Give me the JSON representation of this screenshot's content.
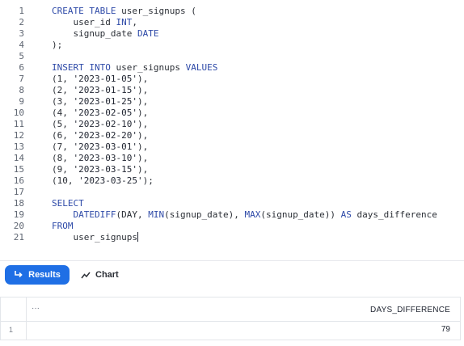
{
  "editor": {
    "lines": [
      {
        "n": "1",
        "parts": [
          {
            "t": "CREATE TABLE",
            "c": "kw"
          },
          {
            "t": " user_signups ("
          }
        ]
      },
      {
        "n": "2",
        "parts": [
          {
            "t": "    user_id "
          },
          {
            "t": "INT",
            "c": "kw"
          },
          {
            "t": ","
          }
        ]
      },
      {
        "n": "3",
        "parts": [
          {
            "t": "    signup_date "
          },
          {
            "t": "DATE",
            "c": "kw"
          }
        ]
      },
      {
        "n": "4",
        "parts": [
          {
            "t": ");"
          }
        ]
      },
      {
        "n": "5",
        "parts": []
      },
      {
        "n": "6",
        "parts": [
          {
            "t": "INSERT INTO",
            "c": "kw"
          },
          {
            "t": " user_signups "
          },
          {
            "t": "VALUES",
            "c": "kw"
          }
        ]
      },
      {
        "n": "7",
        "parts": [
          {
            "t": "(1, "
          },
          {
            "t": "'2023-01-05'",
            "c": "str"
          },
          {
            "t": "),"
          }
        ]
      },
      {
        "n": "8",
        "parts": [
          {
            "t": "(2, "
          },
          {
            "t": "'2023-01-15'",
            "c": "str"
          },
          {
            "t": "),"
          }
        ]
      },
      {
        "n": "9",
        "parts": [
          {
            "t": "(3, "
          },
          {
            "t": "'2023-01-25'",
            "c": "str"
          },
          {
            "t": "),"
          }
        ]
      },
      {
        "n": "10",
        "parts": [
          {
            "t": "(4, "
          },
          {
            "t": "'2023-02-05'",
            "c": "str"
          },
          {
            "t": "),"
          }
        ]
      },
      {
        "n": "11",
        "parts": [
          {
            "t": "(5, "
          },
          {
            "t": "'2023-02-10'",
            "c": "str"
          },
          {
            "t": "),"
          }
        ]
      },
      {
        "n": "12",
        "parts": [
          {
            "t": "(6, "
          },
          {
            "t": "'2023-02-20'",
            "c": "str"
          },
          {
            "t": "),"
          }
        ]
      },
      {
        "n": "13",
        "parts": [
          {
            "t": "(7, "
          },
          {
            "t": "'2023-03-01'",
            "c": "str"
          },
          {
            "t": "),"
          }
        ]
      },
      {
        "n": "14",
        "parts": [
          {
            "t": "(8, "
          },
          {
            "t": "'2023-03-10'",
            "c": "str"
          },
          {
            "t": "),"
          }
        ]
      },
      {
        "n": "15",
        "parts": [
          {
            "t": "(9, "
          },
          {
            "t": "'2023-03-15'",
            "c": "str"
          },
          {
            "t": "),"
          }
        ]
      },
      {
        "n": "16",
        "parts": [
          {
            "t": "(10, "
          },
          {
            "t": "'2023-03-25'",
            "c": "str"
          },
          {
            "t": ");"
          }
        ]
      },
      {
        "n": "17",
        "parts": []
      },
      {
        "n": "18",
        "parts": [
          {
            "t": "SELECT",
            "c": "kw"
          }
        ]
      },
      {
        "n": "19",
        "parts": [
          {
            "t": "    "
          },
          {
            "t": "DATEDIFF",
            "c": "fn"
          },
          {
            "t": "(DAY, "
          },
          {
            "t": "MIN",
            "c": "fn"
          },
          {
            "t": "(signup_date), "
          },
          {
            "t": "MAX",
            "c": "fn"
          },
          {
            "t": "(signup_date)) "
          },
          {
            "t": "AS",
            "c": "kw"
          },
          {
            "t": " days_difference"
          }
        ]
      },
      {
        "n": "20",
        "parts": [
          {
            "t": "FROM",
            "c": "kw"
          }
        ]
      },
      {
        "n": "21",
        "parts": [
          {
            "t": "    user_signups"
          }
        ],
        "caret": true
      }
    ]
  },
  "tabs": {
    "results_label": "Results",
    "chart_label": "Chart",
    "active": "results"
  },
  "results": {
    "header_menu": "···",
    "columns": [
      "DAYS_DIFFERENCE"
    ],
    "rows": [
      {
        "num": "1",
        "values": [
          "79"
        ]
      }
    ]
  },
  "colors": {
    "accent": "#1f6fe5",
    "keyword": "#2e4aa8",
    "text": "#2b2f36"
  },
  "icons": {
    "results_tab": "arrow-return-icon",
    "chart_tab": "line-chart-icon"
  }
}
